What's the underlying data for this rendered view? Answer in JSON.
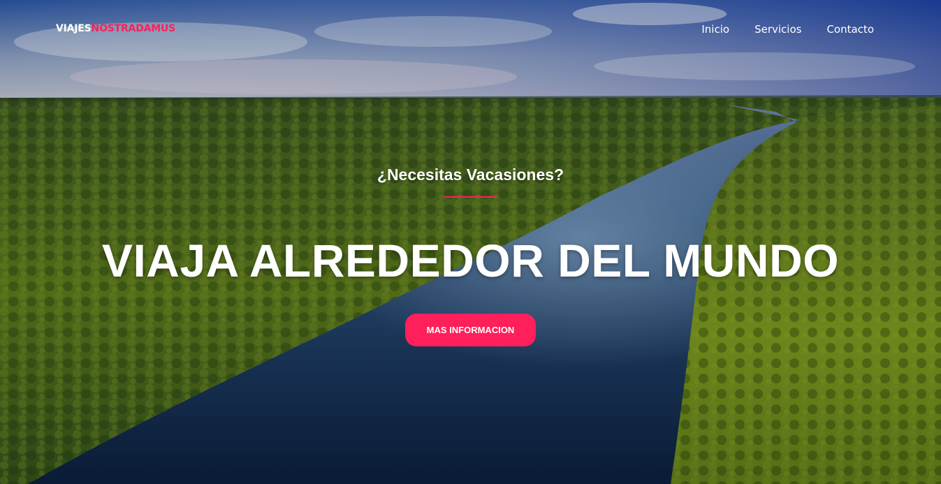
{
  "brand": {
    "part1": "VIAJES",
    "part2": "NOSTRADAMUS"
  },
  "nav": {
    "items": [
      {
        "label": "Inicio"
      },
      {
        "label": "Servicios"
      },
      {
        "label": "Contacto"
      }
    ]
  },
  "hero": {
    "subtitle": "¿Necesitas Vacasiones?",
    "headline": "VIAJA ALREDEDOR DEL MUNDO",
    "cta_label": "MAS INFORMACION"
  },
  "colors": {
    "accent": "#ff1f5a",
    "text": "#ffffff"
  }
}
